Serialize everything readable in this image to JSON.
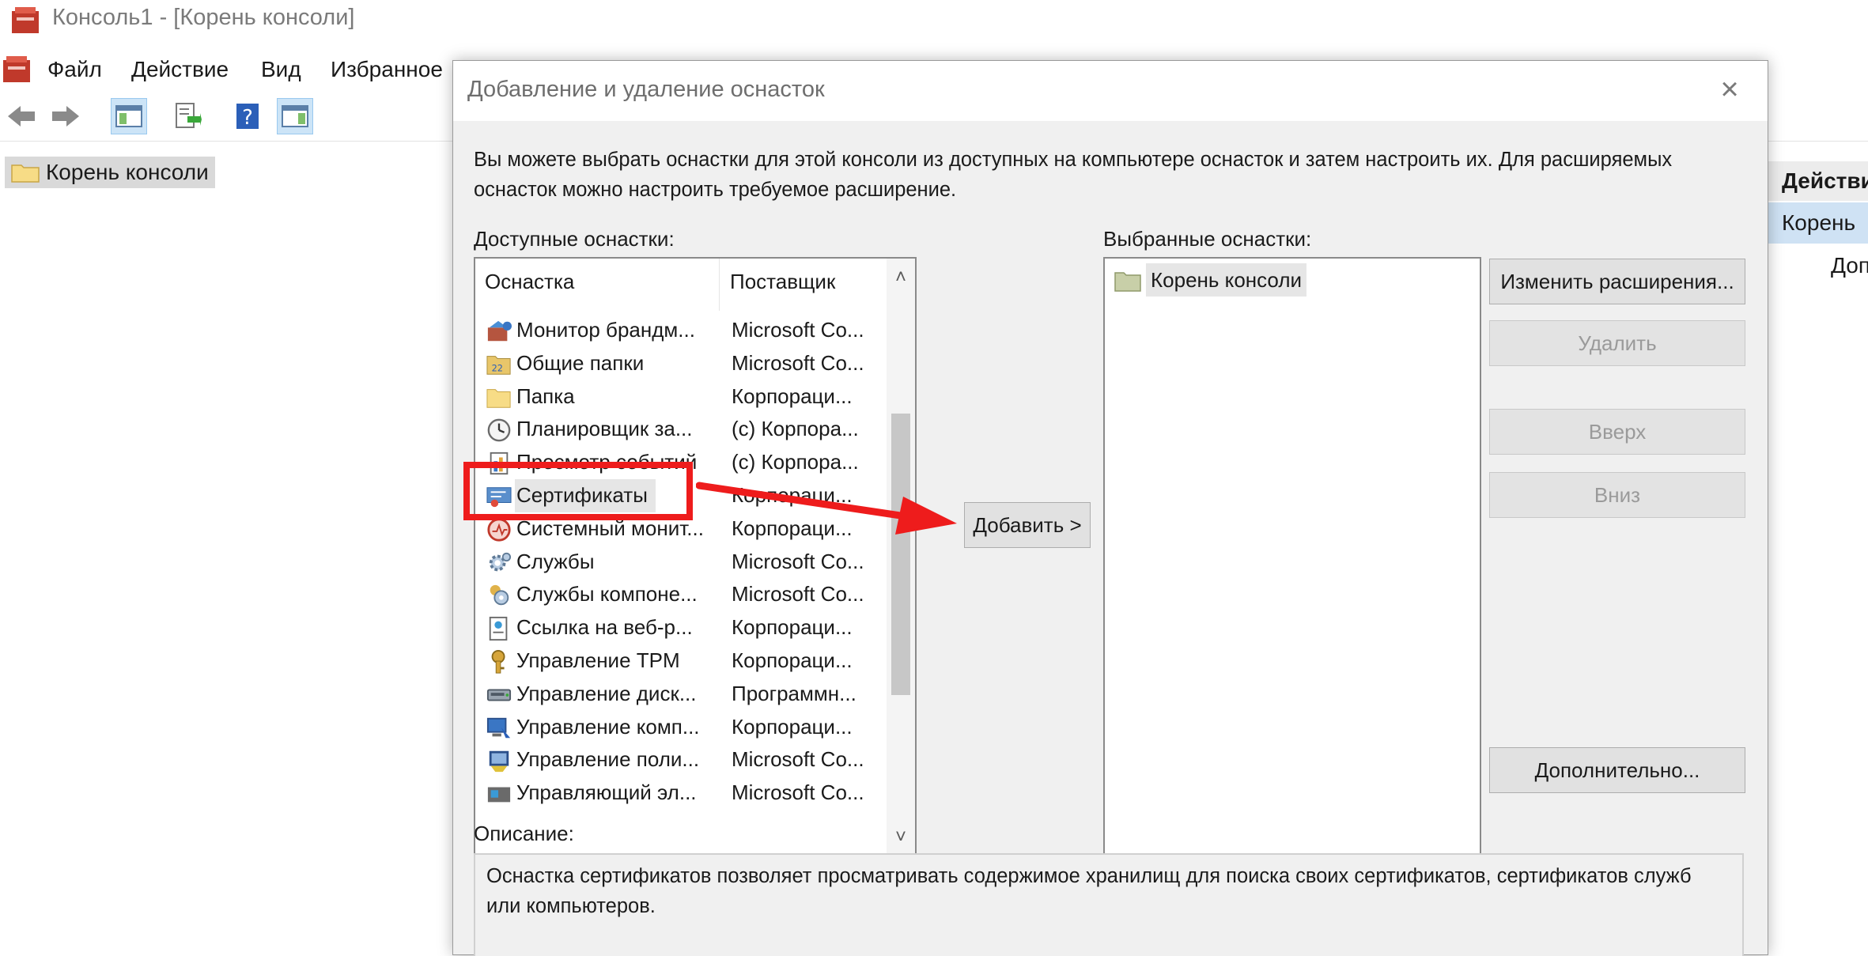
{
  "window": {
    "title": "Консоль1 - [Корень консоли]",
    "menu": [
      "Файл",
      "Действие",
      "Вид",
      "Избранное"
    ]
  },
  "tree": {
    "root_label": "Корень консоли"
  },
  "actions_pane": {
    "header": "Действи",
    "selected": "Корень",
    "sub": "Доп"
  },
  "dialog": {
    "title": "Добавление и удаление оснасток",
    "close": "×",
    "intro": "Вы можете выбрать оснастки для этой консоли из доступных на компьютере оснасток и затем настроить их. Для расширяемых оснасток можно настроить требуемое расширение.",
    "available_label": "Доступные оснастки:",
    "columns": [
      "Оснастка",
      "Поставщик"
    ],
    "available": [
      {
        "name": "Монитор брандм...",
        "vendor": "Microsoft Co...",
        "icon": "firewall-icon"
      },
      {
        "name": "Общие папки",
        "vendor": "Microsoft Co...",
        "icon": "shared-folders-icon"
      },
      {
        "name": "Папка",
        "vendor": "Корпораци...",
        "icon": "folder-icon"
      },
      {
        "name": "Планировщик за...",
        "vendor": "(с) Корпора...",
        "icon": "clock-icon"
      },
      {
        "name": "Просмотр событий",
        "vendor": "(с) Корпора...",
        "icon": "event-viewer-icon"
      },
      {
        "name": "Сертификаты",
        "vendor": "Корпораци...",
        "icon": "certificate-icon"
      },
      {
        "name": "Системный монит...",
        "vendor": "Корпораци...",
        "icon": "system-monitor-icon"
      },
      {
        "name": "Службы",
        "vendor": "Microsoft Co...",
        "icon": "services-gear-icon"
      },
      {
        "name": "Службы компоне...",
        "vendor": "Microsoft Co...",
        "icon": "component-services-icon"
      },
      {
        "name": "Ссылка на веб-р...",
        "vendor": "Корпораци...",
        "icon": "web-link-icon"
      },
      {
        "name": "Управление TPM",
        "vendor": "Корпораци...",
        "icon": "tpm-key-icon"
      },
      {
        "name": "Управление диск...",
        "vendor": "Программн...",
        "icon": "disk-icon"
      },
      {
        "name": "Управление комп...",
        "vendor": "Корпораци...",
        "icon": "computer-management-icon"
      },
      {
        "name": "Управление поли...",
        "vendor": "Microsoft Co...",
        "icon": "policy-icon"
      },
      {
        "name": "Управляющий эл...",
        "vendor": "Microsoft Co...",
        "icon": "control-icon"
      }
    ],
    "selected_label": "Выбранные оснастки:",
    "selected_items": [
      "Корень консоли"
    ],
    "add_button": "Добавить >",
    "buttons": {
      "edit_extensions": "Изменить расширения...",
      "remove": "Удалить",
      "up": "Вверх",
      "down": "Вниз",
      "advanced": "Дополнительно..."
    },
    "description_label": "Описание:",
    "description": "Оснастка сертификатов позволяет просматривать содержимое хранилищ для поиска своих сертификатов, сертификатов служб или компьютеров."
  },
  "annotation": {
    "highlight_color": "#ee1c1c"
  }
}
